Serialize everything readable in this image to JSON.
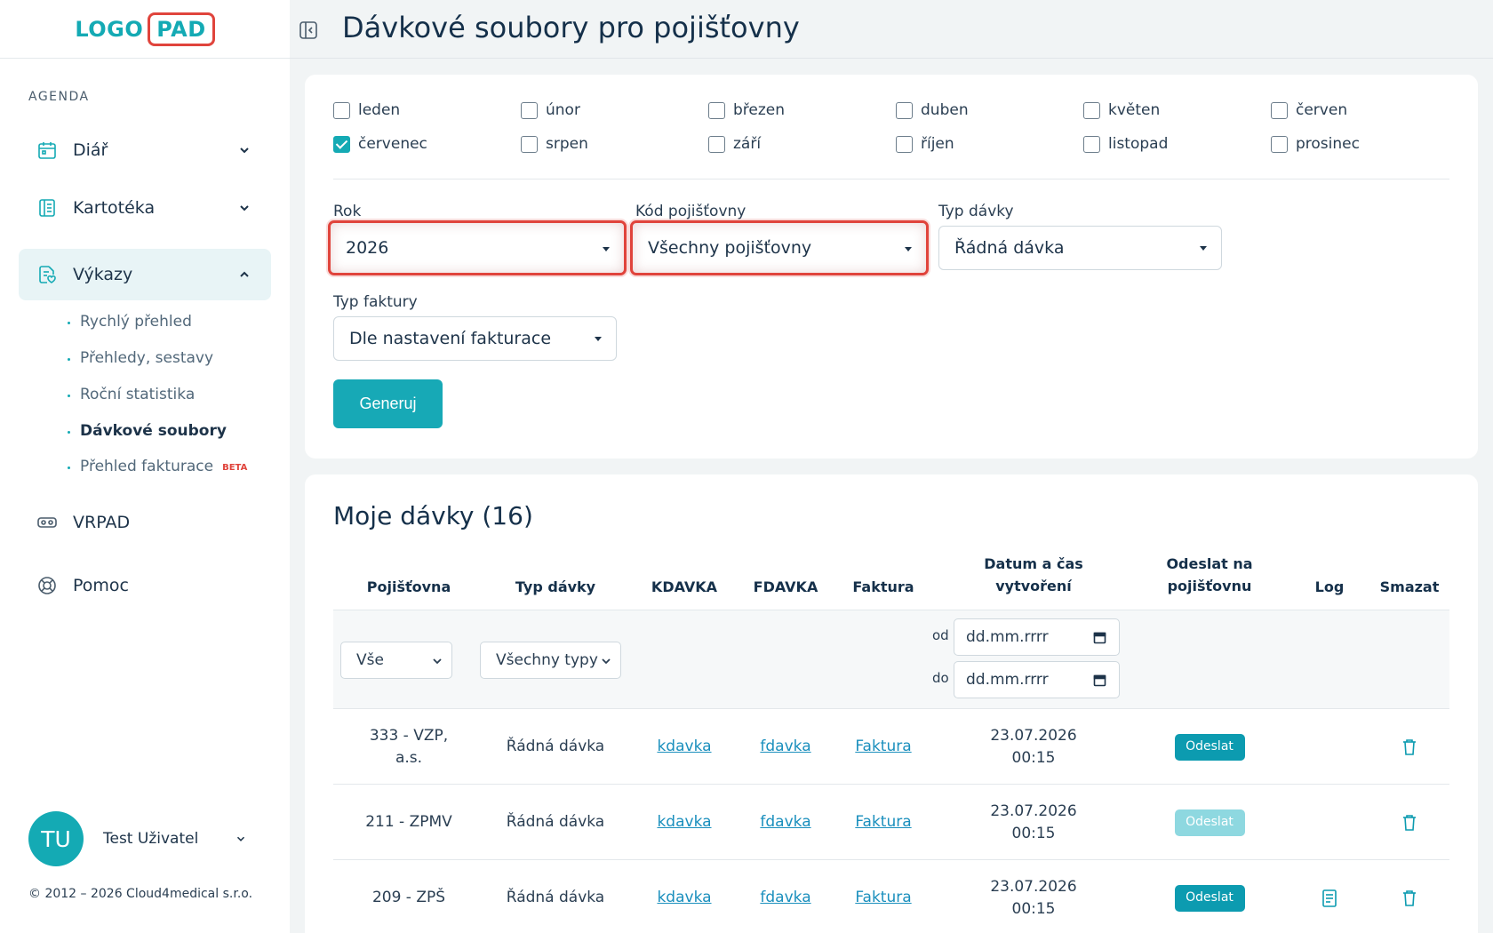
{
  "logo": {
    "part1": "LOGO",
    "part2": "PAD"
  },
  "sidebar": {
    "section_label": "AGENDA",
    "nav": [
      {
        "label": "Diář",
        "icon": "calendar-icon"
      },
      {
        "label": "Kartotéka",
        "icon": "card-index-icon"
      },
      {
        "label": "Výkazy",
        "icon": "report-icon"
      },
      {
        "label": "VRPAD",
        "icon": "vr-headset-icon"
      },
      {
        "label": "Pomoc",
        "icon": "lifebuoy-icon"
      }
    ],
    "subnav": [
      {
        "label": "Rychlý přehled"
      },
      {
        "label": "Přehledy, sestavy"
      },
      {
        "label": "Roční statistika"
      },
      {
        "label": "Dávkové soubory"
      },
      {
        "label": "Přehled fakturace",
        "badge": "BETA"
      }
    ],
    "user": {
      "initials": "TU",
      "name": "Test Uživatel"
    },
    "copyright": "© 2012 – 2026 Cloud4medical s.r.o."
  },
  "header": {
    "title": "Dávkové soubory pro pojišťovny"
  },
  "filters": {
    "months": [
      {
        "label": "leden",
        "checked": false
      },
      {
        "label": "únor",
        "checked": false
      },
      {
        "label": "březen",
        "checked": false
      },
      {
        "label": "duben",
        "checked": false
      },
      {
        "label": "květen",
        "checked": false
      },
      {
        "label": "červen",
        "checked": false
      },
      {
        "label": "červenec",
        "checked": true
      },
      {
        "label": "srpen",
        "checked": false
      },
      {
        "label": "září",
        "checked": false
      },
      {
        "label": "říjen",
        "checked": false
      },
      {
        "label": "listopad",
        "checked": false
      },
      {
        "label": "prosinec",
        "checked": false
      }
    ],
    "year": {
      "label": "Rok",
      "value": "2026"
    },
    "insurer": {
      "label": "Kód pojišťovny",
      "value": "Všechny pojišťovny"
    },
    "batch_type": {
      "label": "Typ dávky",
      "value": "Řádná dávka"
    },
    "invoice_type": {
      "label": "Typ faktury",
      "value": "Dle nastavení fakturace"
    },
    "generate_label": "Generuj"
  },
  "batches": {
    "title": "Moje dávky (16)",
    "columns": {
      "insurer": "Pojišťovna",
      "type": "Typ dávky",
      "kdavka": "KDAVKA",
      "fdavka": "FDAVKA",
      "invoice": "Faktura",
      "created_line1": "Datum a čas",
      "created_line2": "vytvoření",
      "send_line1": "Odeslat na",
      "send_line2": "pojišťovnu",
      "log": "Log",
      "delete": "Smazat"
    },
    "filter": {
      "insurer_value": "Vše",
      "type_value": "Všechny typy",
      "from_label": "od",
      "to_label": "do",
      "date_placeholder": "dd.mm.rrrr"
    },
    "rows": [
      {
        "insurer_line1": "333 - VZP,",
        "insurer_line2": "a.s.",
        "type": "Řádná dávka",
        "kdavka": "kdavka",
        "fdavka": "fdavka",
        "invoice": "Faktura",
        "date": "23.07.2026",
        "time": "00:15",
        "send": "Odeslat",
        "send_enabled": true,
        "has_log": false
      },
      {
        "insurer_line1": "211 - ZPMV",
        "insurer_line2": "",
        "type": "Řádná dávka",
        "kdavka": "kdavka",
        "fdavka": "fdavka",
        "invoice": "Faktura",
        "date": "23.07.2026",
        "time": "00:15",
        "send": "Odeslat",
        "send_enabled": false,
        "has_log": false
      },
      {
        "insurer_line1": "209 - ZPŠ",
        "insurer_line2": "",
        "type": "Řádná dávka",
        "kdavka": "kdavka",
        "fdavka": "fdavka",
        "invoice": "Faktura",
        "date": "23.07.2026",
        "time": "00:15",
        "send": "Odeslat",
        "send_enabled": true,
        "has_log": true
      }
    ]
  },
  "colors": {
    "accent": "#14aab4",
    "highlight": "#e0443c",
    "text": "#1d3349"
  }
}
